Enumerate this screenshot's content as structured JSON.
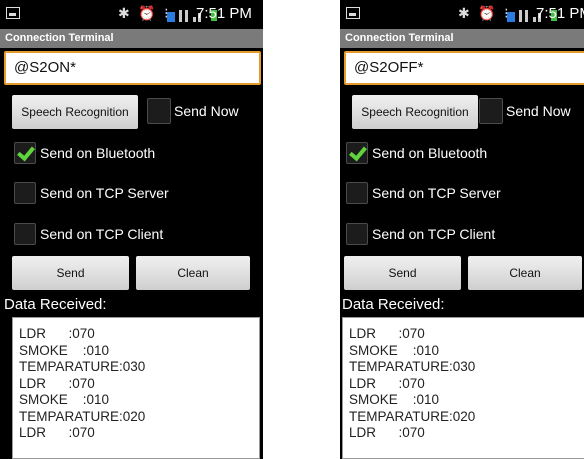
{
  "screens": [
    {
      "status_time": "7:51 PM",
      "title": "Connection Terminal",
      "command_value": "@S2ON*",
      "speech_button": "Speech Recognition",
      "send_now_label": "Send Now",
      "send_now_checked": false,
      "bluetooth_label": "Send on Bluetooth",
      "bluetooth_checked": true,
      "tcp_server_label": "Send on TCP Server",
      "tcp_server_checked": false,
      "tcp_client_label": "Send on TCP Client",
      "tcp_client_checked": false,
      "send_button": "Send",
      "clean_button": "Clean",
      "data_received_label": "Data Received:",
      "received_lines": [
        "LDR      :070",
        "SMOKE    :010",
        "TEMPARATURE:030",
        "LDR      :070",
        "SMOKE    :010",
        "TEMPARATURE:020",
        "LDR      :070"
      ]
    },
    {
      "status_time": "7:51 PM",
      "title": "Connection Terminal",
      "command_value": "@S2OFF*",
      "speech_button": "Speech Recognition",
      "send_now_label": "Send Now",
      "send_now_checked": false,
      "bluetooth_label": "Send on Bluetooth",
      "bluetooth_checked": true,
      "tcp_server_label": "Send on TCP Server",
      "tcp_server_checked": false,
      "tcp_client_label": "Send on TCP Client",
      "tcp_client_checked": false,
      "send_button": "Send",
      "clean_button": "Clean",
      "data_received_label": "Data Received:",
      "received_lines": [
        "LDR      :070",
        "SMOKE    :010",
        "TEMPARATURE:030",
        "LDR      :070",
        "SMOKE    :010",
        "TEMPARATURE:020",
        "LDR      :070"
      ]
    }
  ],
  "colors": {
    "accent_border": "#e79b2e",
    "check": "#5fd43c",
    "titlebar": "#7a7a7a",
    "battery": "#3fbf3f"
  },
  "icons": [
    "screenshot-icon",
    "bluetooth-icon",
    "alarm-icon",
    "signal-icon",
    "battery-icon",
    "check-icon"
  ]
}
